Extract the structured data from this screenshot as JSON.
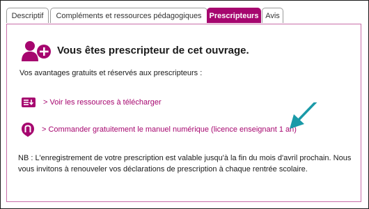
{
  "tabs": [
    {
      "label": "Descriptif",
      "active": false
    },
    {
      "label": "Compléments et ressources pédagogiques",
      "active": false
    },
    {
      "label": "Prescripteurs",
      "active": true
    },
    {
      "label": "Avis",
      "active": false
    }
  ],
  "panel": {
    "title": "Vous êtes prescripteur de cet ouvrage.",
    "subtitle": "Vos avantages gratuits et réservés aux prescripteurs :",
    "links": [
      {
        "label": "> Voir les ressources à télécharger",
        "icon": "download-resources-icon"
      },
      {
        "label": "> Commander gratuitement le manuel numérique (licence enseignant 1 an)",
        "icon": "digital-manual-icon"
      }
    ],
    "note": "NB : L'enregistrement de votre prescription est valable jusqu'à la fin du mois d'avril prochain. Nous vous invitons à renouveler vos déclarations de prescription à chaque rentrée scolaire."
  },
  "colors": {
    "accent": "#a6066f",
    "arrow": "#1a9aa8"
  }
}
